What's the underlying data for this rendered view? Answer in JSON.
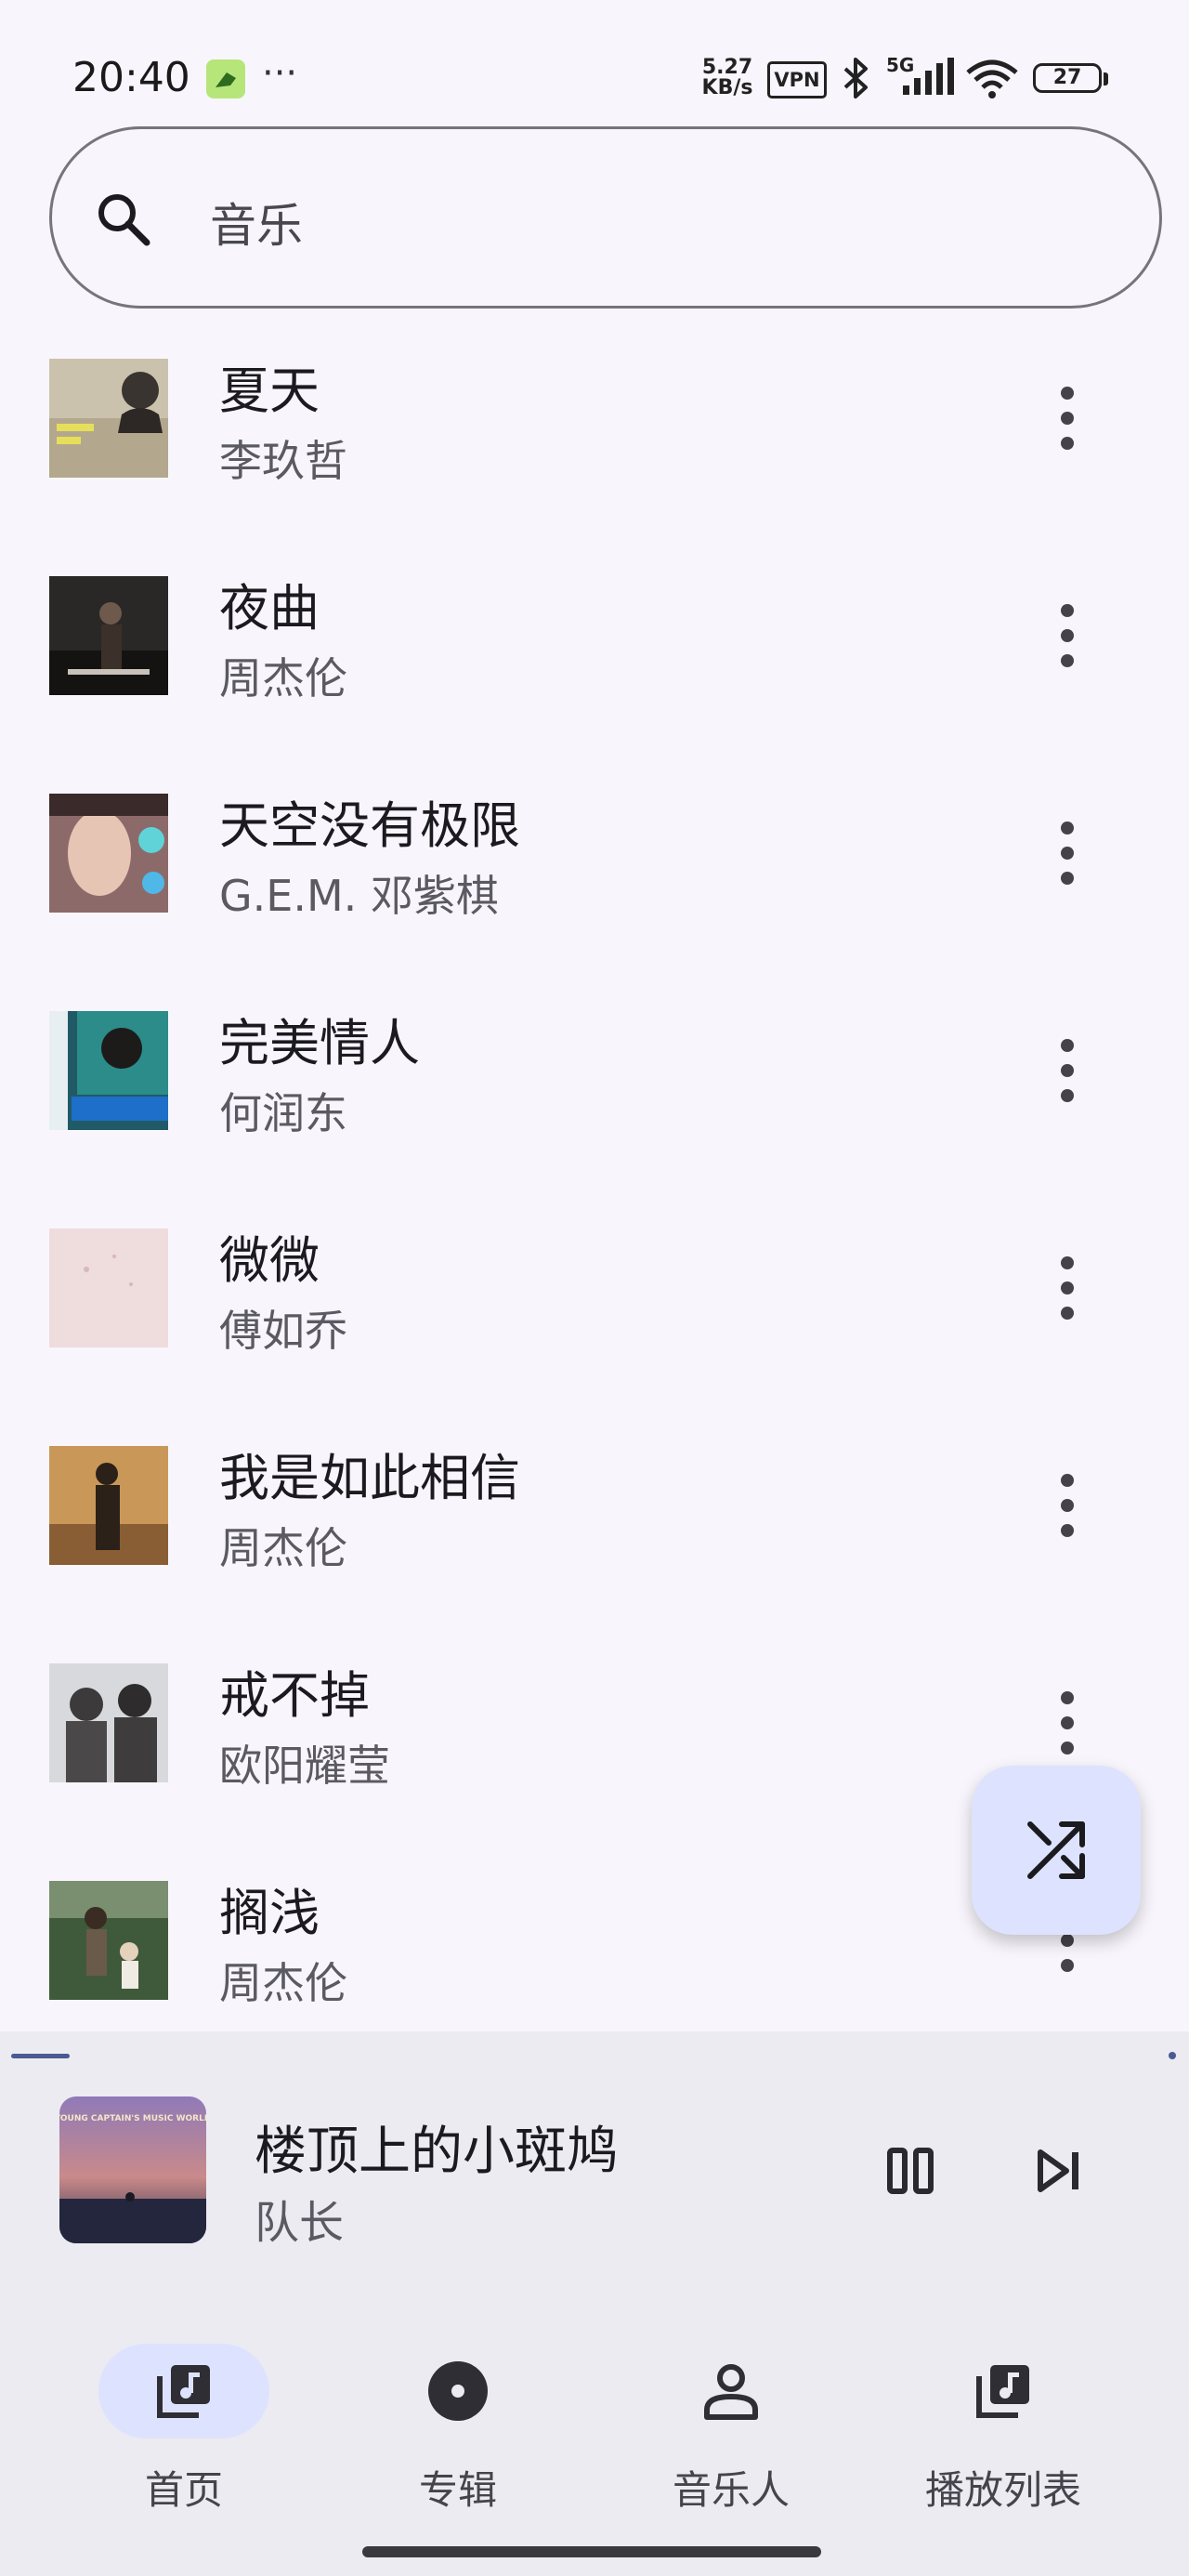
{
  "status_bar": {
    "time": "20:40",
    "more_indicator": "···",
    "net_speed_value": "5.27",
    "net_speed_unit": "KB/s",
    "vpn": "VPN",
    "network": "5G",
    "battery": "27"
  },
  "search": {
    "text": "音乐",
    "icon": "search-icon"
  },
  "songs": [
    {
      "title": "夏天",
      "artist": "李玖哲"
    },
    {
      "title": "夜曲",
      "artist": "周杰伦"
    },
    {
      "title": "天空没有极限",
      "artist": "G.E.M. 邓紫棋"
    },
    {
      "title": "完美情人",
      "artist": "何润东"
    },
    {
      "title": "微微",
      "artist": "傅如乔"
    },
    {
      "title": "我是如此相信",
      "artist": "周杰伦"
    },
    {
      "title": "戒不掉",
      "artist": "欧阳耀莹"
    },
    {
      "title": "搁浅",
      "artist": "周杰伦"
    }
  ],
  "fab": {
    "icon": "shuffle-icon"
  },
  "now_playing": {
    "title": "楼顶上的小斑鸠",
    "artist": "队长",
    "progress": 0.05,
    "cover_text": "YOUNG CAPTAIN'S MUSIC WORLD"
  },
  "nav": {
    "items": [
      {
        "label": "首页",
        "icon": "music-library-icon",
        "selected": true
      },
      {
        "label": "专辑",
        "icon": "album-disc-icon",
        "selected": false
      },
      {
        "label": "音乐人",
        "icon": "person-icon",
        "selected": false
      },
      {
        "label": "播放列表",
        "icon": "playlist-icon",
        "selected": false
      }
    ]
  },
  "colors": {
    "background": "#f8f6fc",
    "accent_container": "#dde3ff",
    "accent": "#4a5a93",
    "surface_variant": "#ecebf1"
  }
}
